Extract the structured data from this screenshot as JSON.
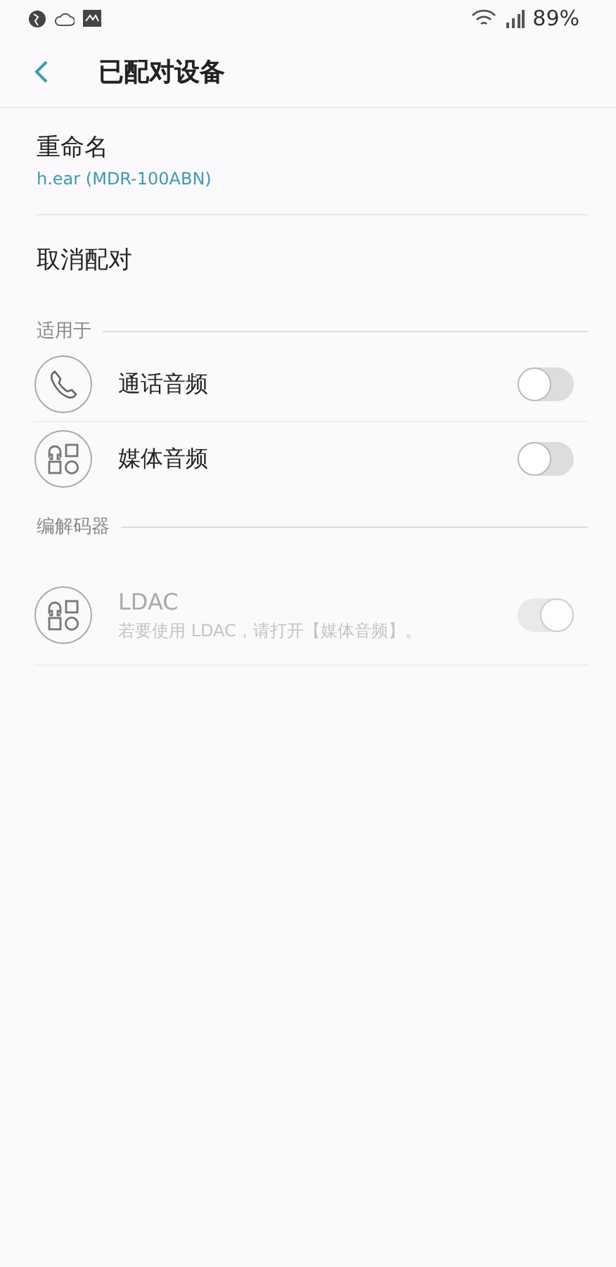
{
  "status_bar": {
    "battery": "89%"
  },
  "header": {
    "title": "已配对设备"
  },
  "rename": {
    "label": "重命名",
    "value": "h.ear (MDR-100ABN)"
  },
  "unpair": {
    "label": "取消配对"
  },
  "sections": [
    {
      "title": "适用于",
      "items": [
        {
          "kind": "phone",
          "label": "通话音频",
          "on": false,
          "disabled": false
        },
        {
          "kind": "media",
          "label": "媒体音频",
          "on": false,
          "disabled": false
        }
      ]
    },
    {
      "title": "编解码器",
      "items": [
        {
          "kind": "media",
          "label": "LDAC",
          "subtitle": "若要使用 LDAC，请打开【媒体音频】。",
          "on": true,
          "disabled": true
        }
      ]
    }
  ]
}
